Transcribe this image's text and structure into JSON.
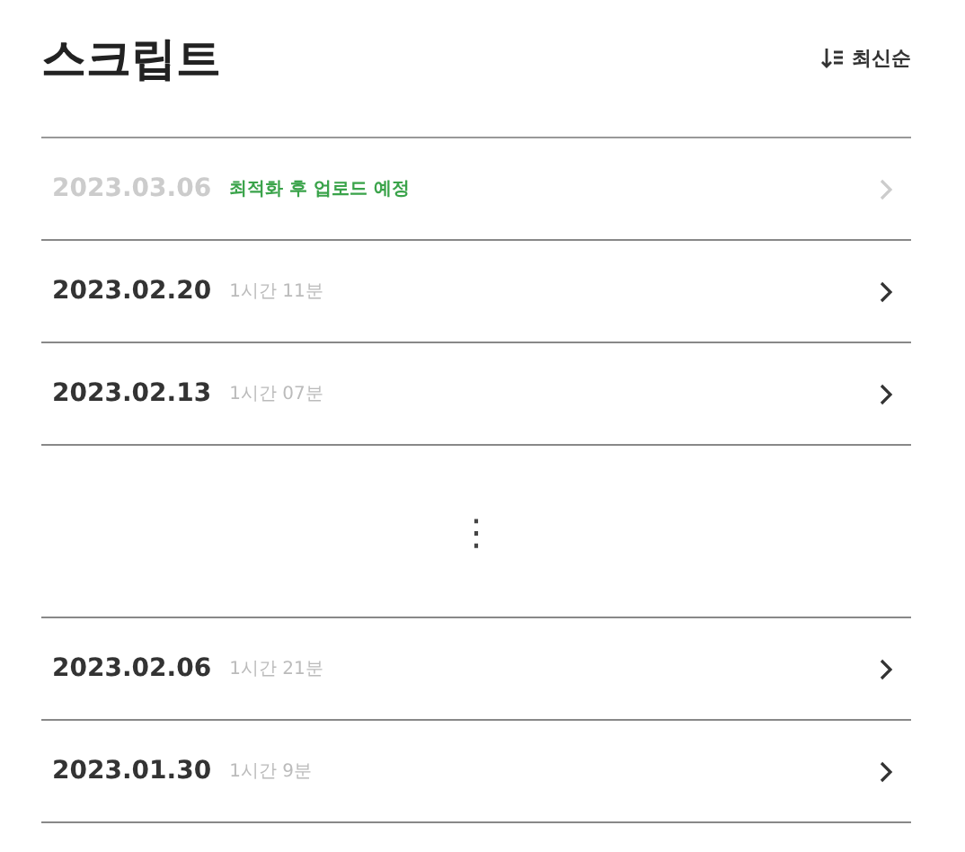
{
  "title": "스크립트",
  "sort": {
    "label": "최신순"
  },
  "items": [
    {
      "kind": "script",
      "date": "2023.03.06",
      "note": "최적화 후 업로드 예정",
      "disabled": true
    },
    {
      "kind": "script",
      "date": "2023.02.20",
      "duration": "1시간 11분",
      "disabled": false
    },
    {
      "kind": "script",
      "date": "2023.02.13",
      "duration": "1시간 07분",
      "disabled": false
    },
    {
      "kind": "gap",
      "symbol": "⋮"
    },
    {
      "kind": "script",
      "date": "2023.02.06",
      "duration": "1시간 21분",
      "disabled": false
    },
    {
      "kind": "script",
      "date": "2023.01.30",
      "duration": "1시간 9분",
      "disabled": false
    }
  ]
}
